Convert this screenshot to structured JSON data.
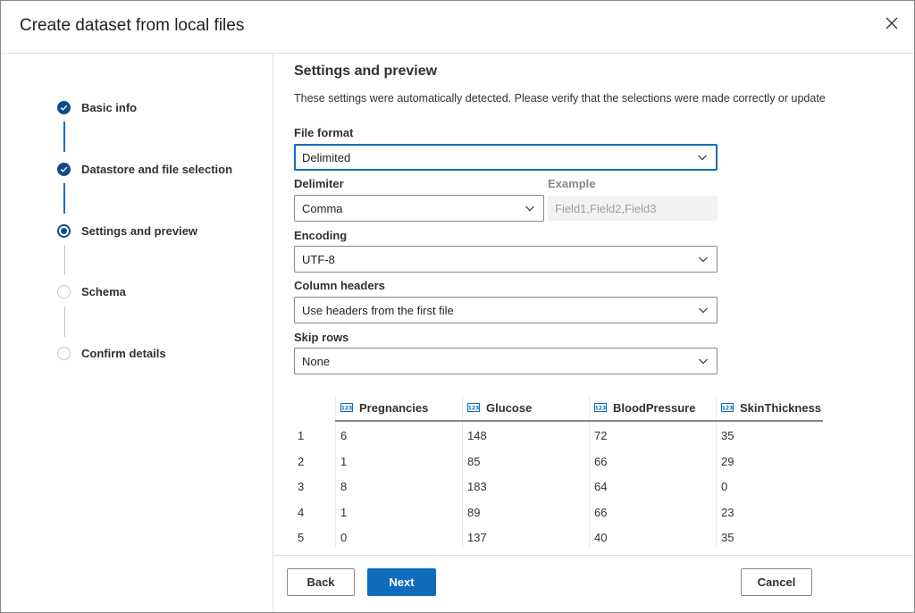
{
  "dialog": {
    "title": "Create dataset from local files",
    "close_icon": "close-icon"
  },
  "wizard_steps": [
    {
      "label": "Basic info",
      "state": "complete"
    },
    {
      "label": "Datastore and file selection",
      "state": "complete"
    },
    {
      "label": "Settings and preview",
      "state": "current"
    },
    {
      "label": "Schema",
      "state": "upcoming"
    },
    {
      "label": "Confirm details",
      "state": "upcoming"
    }
  ],
  "settings": {
    "title": "Settings and preview",
    "description": "These settings were automatically detected. Please verify that the selections were made correctly or update",
    "file_format": {
      "label": "File format",
      "value": "Delimited"
    },
    "delimiter": {
      "label": "Delimiter",
      "value": "Comma"
    },
    "example": {
      "label": "Example",
      "value": "Field1,Field2,Field3"
    },
    "encoding": {
      "label": "Encoding",
      "value": "UTF-8"
    },
    "column_headers": {
      "label": "Column headers",
      "value": "Use headers from the first file"
    },
    "skip_rows": {
      "label": "Skip rows",
      "value": "None"
    }
  },
  "preview_table": {
    "column_type_icon": "numeric-column-icon",
    "columns": [
      "Pregnancies",
      "Glucose",
      "BloodPressure",
      "SkinThickness"
    ],
    "rows": [
      {
        "index": "1",
        "cells": [
          "6",
          "148",
          "72",
          "35"
        ]
      },
      {
        "index": "2",
        "cells": [
          "1",
          "85",
          "66",
          "29"
        ]
      },
      {
        "index": "3",
        "cells": [
          "8",
          "183",
          "64",
          "0"
        ]
      },
      {
        "index": "4",
        "cells": [
          "1",
          "89",
          "66",
          "23"
        ]
      },
      {
        "index": "5",
        "cells": [
          "0",
          "137",
          "40",
          "35"
        ]
      }
    ]
  },
  "footer": {
    "back_label": "Back",
    "next_label": "Next",
    "cancel_label": "Cancel"
  },
  "colors": {
    "accent": "#0f6cbd",
    "step_complete": "#0f4a8a",
    "border": "#8a8886"
  }
}
